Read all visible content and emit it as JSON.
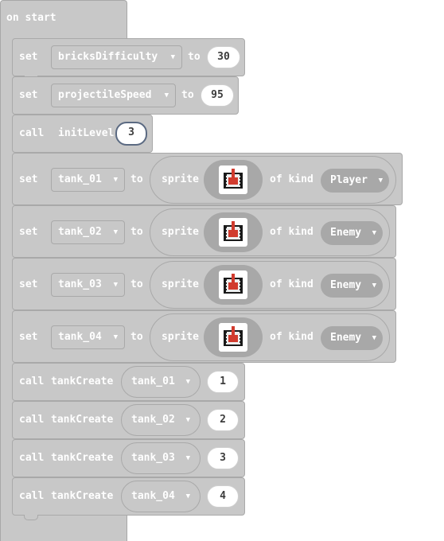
{
  "hat": {
    "label": "on start"
  },
  "kw": {
    "set": "set",
    "to": "to",
    "call": "call",
    "sprite": "sprite",
    "of_kind": "of kind"
  },
  "vars": [
    {
      "name": "bricksDifficulty",
      "value": "30"
    },
    {
      "name": "projectileSpeed",
      "value": "95"
    }
  ],
  "init": {
    "func": "initLevel",
    "arg": "3"
  },
  "sprites": [
    {
      "var": "tank_01",
      "kind": "Player"
    },
    {
      "var": "tank_02",
      "kind": "Enemy"
    },
    {
      "var": "tank_03",
      "kind": "Enemy"
    },
    {
      "var": "tank_04",
      "kind": "Enemy"
    }
  ],
  "tank_creates": [
    {
      "func": "tankCreate",
      "tank": "tank_01",
      "arg": "1"
    },
    {
      "func": "tankCreate",
      "tank": "tank_02",
      "arg": "2"
    },
    {
      "func": "tankCreate",
      "tank": "tank_03",
      "arg": "3"
    },
    {
      "func": "tankCreate",
      "tank": "tank_04",
      "arg": "4"
    }
  ],
  "icons": {
    "caret": "caret-down-icon",
    "sprite": "tank-sprite-icon"
  },
  "colors": {
    "block": "#c8c8c8",
    "border": "#a9a9a9",
    "thumb": "#a8a8a8",
    "tank_red": "#d13b2e"
  }
}
